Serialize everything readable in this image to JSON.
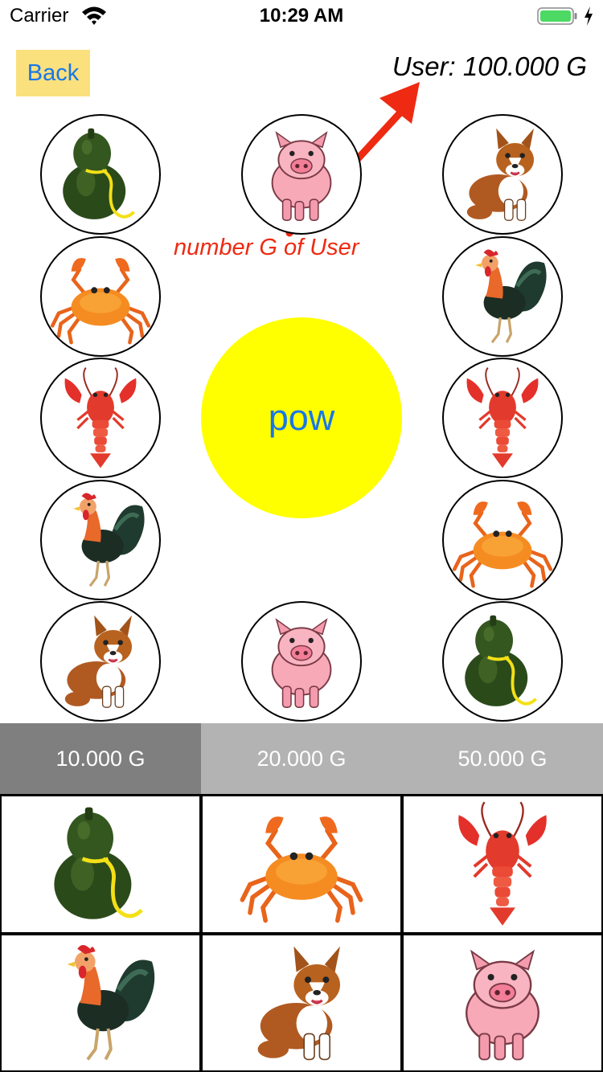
{
  "status_bar": {
    "carrier": "Carrier",
    "time": "10:29 AM"
  },
  "header": {
    "back_label": "Back",
    "user_balance": "User: 100.000 G"
  },
  "annotation": {
    "text": "number G of User",
    "color": "#ee2a12"
  },
  "pow": {
    "label": "pow",
    "color": "#ffff00"
  },
  "board": [
    "gourd-icon",
    "pig-icon",
    "dog-icon",
    "crab-icon",
    "rooster-icon",
    "lobster-icon",
    "lobster-icon",
    "rooster-icon",
    "crab-icon",
    "dog-icon",
    "pig-icon",
    "gourd-icon"
  ],
  "bet_tabs": [
    {
      "label": "10.000 G",
      "active": true
    },
    {
      "label": "20.000 G",
      "active": false
    },
    {
      "label": "50.000 G",
      "active": false
    }
  ],
  "pick_grid": [
    "gourd-icon",
    "crab-icon",
    "lobster-icon",
    "rooster-icon",
    "dog-icon",
    "pig-icon"
  ]
}
